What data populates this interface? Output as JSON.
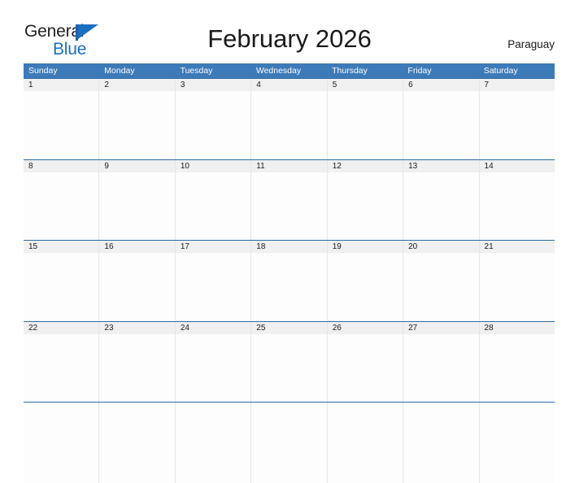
{
  "logo": {
    "line1": "General",
    "line2": "Blue",
    "flag_icon": "blue-flag-triangle-icon",
    "text_color": "#231f20",
    "accent_color": "#1b6fc0"
  },
  "header": {
    "title": "February 2026",
    "country": "Paraguay"
  },
  "theme": {
    "header_blue": "#3d7ab8",
    "row_divider_blue": "#2e6da8",
    "day_band_gray": "#f0f0f0",
    "cell_white": "#fdfdfd",
    "column_divider": "#e6e6e6"
  },
  "calendar": {
    "month": "February",
    "year": "2026",
    "weekdays": [
      "Sunday",
      "Monday",
      "Tuesday",
      "Wednesday",
      "Thursday",
      "Friday",
      "Saturday"
    ],
    "weeks": [
      {
        "days": [
          {
            "number": "1"
          },
          {
            "number": "2"
          },
          {
            "number": "3"
          },
          {
            "number": "4"
          },
          {
            "number": "5"
          },
          {
            "number": "6"
          },
          {
            "number": "7"
          }
        ]
      },
      {
        "days": [
          {
            "number": "8"
          },
          {
            "number": "9"
          },
          {
            "number": "10"
          },
          {
            "number": "11"
          },
          {
            "number": "12"
          },
          {
            "number": "13"
          },
          {
            "number": "14"
          }
        ]
      },
      {
        "days": [
          {
            "number": "15"
          },
          {
            "number": "16"
          },
          {
            "number": "17"
          },
          {
            "number": "18"
          },
          {
            "number": "19"
          },
          {
            "number": "20"
          },
          {
            "number": "21"
          }
        ]
      },
      {
        "days": [
          {
            "number": "22"
          },
          {
            "number": "23"
          },
          {
            "number": "24"
          },
          {
            "number": "25"
          },
          {
            "number": "26"
          },
          {
            "number": "27"
          },
          {
            "number": "28"
          }
        ]
      },
      {
        "days": [
          {
            "number": ""
          },
          {
            "number": ""
          },
          {
            "number": ""
          },
          {
            "number": ""
          },
          {
            "number": ""
          },
          {
            "number": ""
          },
          {
            "number": ""
          }
        ]
      }
    ]
  }
}
